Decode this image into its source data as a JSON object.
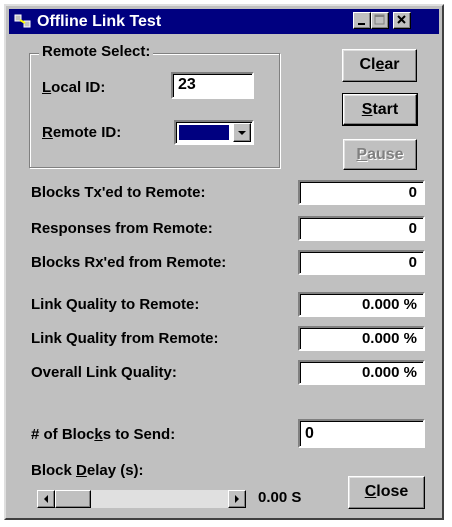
{
  "window": {
    "title": "Offline Link Test"
  },
  "remote_select": {
    "group_label": "Remote Select:",
    "local_id_label_u": "L",
    "local_id_label_rest": "ocal ID:",
    "local_id_value": "23",
    "remote_id_label_u": "R",
    "remote_id_label_rest": "emote ID:"
  },
  "buttons": {
    "clear_pre": "Cl",
    "clear_u": "e",
    "clear_post": "ar",
    "start_u": "S",
    "start_rest": "tart",
    "pause_u": "P",
    "pause_rest": "ause",
    "close_u": "C",
    "close_rest": "lose"
  },
  "stats": {
    "blocks_tx_label": "Blocks Tx'ed to Remote:",
    "blocks_tx_value": "0",
    "responses_label": "Responses from Remote:",
    "responses_value": "0",
    "blocks_rx_label": "Blocks Rx'ed from Remote:",
    "blocks_rx_value": "0",
    "quality_to_label": "Link Quality to Remote:",
    "quality_to_value": "0.000 %",
    "quality_from_label": "Link Quality from Remote:",
    "quality_from_value": "0.000 %",
    "overall_label": "Overall Link Quality:",
    "overall_value": "0.000 %"
  },
  "send": {
    "blocks_label_pre": "# of Bloc",
    "blocks_label_u": "k",
    "blocks_label_post": "s to Send:",
    "blocks_value": "0",
    "delay_label_pre": "Block ",
    "delay_label_u": "D",
    "delay_label_post": "elay (s):",
    "delay_value": "0.00 S",
    "delay_slider_position": 0.0
  },
  "colors": {
    "title_bar": "#000080",
    "face": "#c0c0c0",
    "remote_id_swatch": "#000080"
  },
  "icons": {
    "app": "link-test-app-icon",
    "minimize": "minimize-icon",
    "maximize": "maximize-icon",
    "close": "close-icon",
    "combo": "chevron-down-icon",
    "scroll_left": "arrow-left-icon",
    "scroll_right": "arrow-right-icon"
  }
}
